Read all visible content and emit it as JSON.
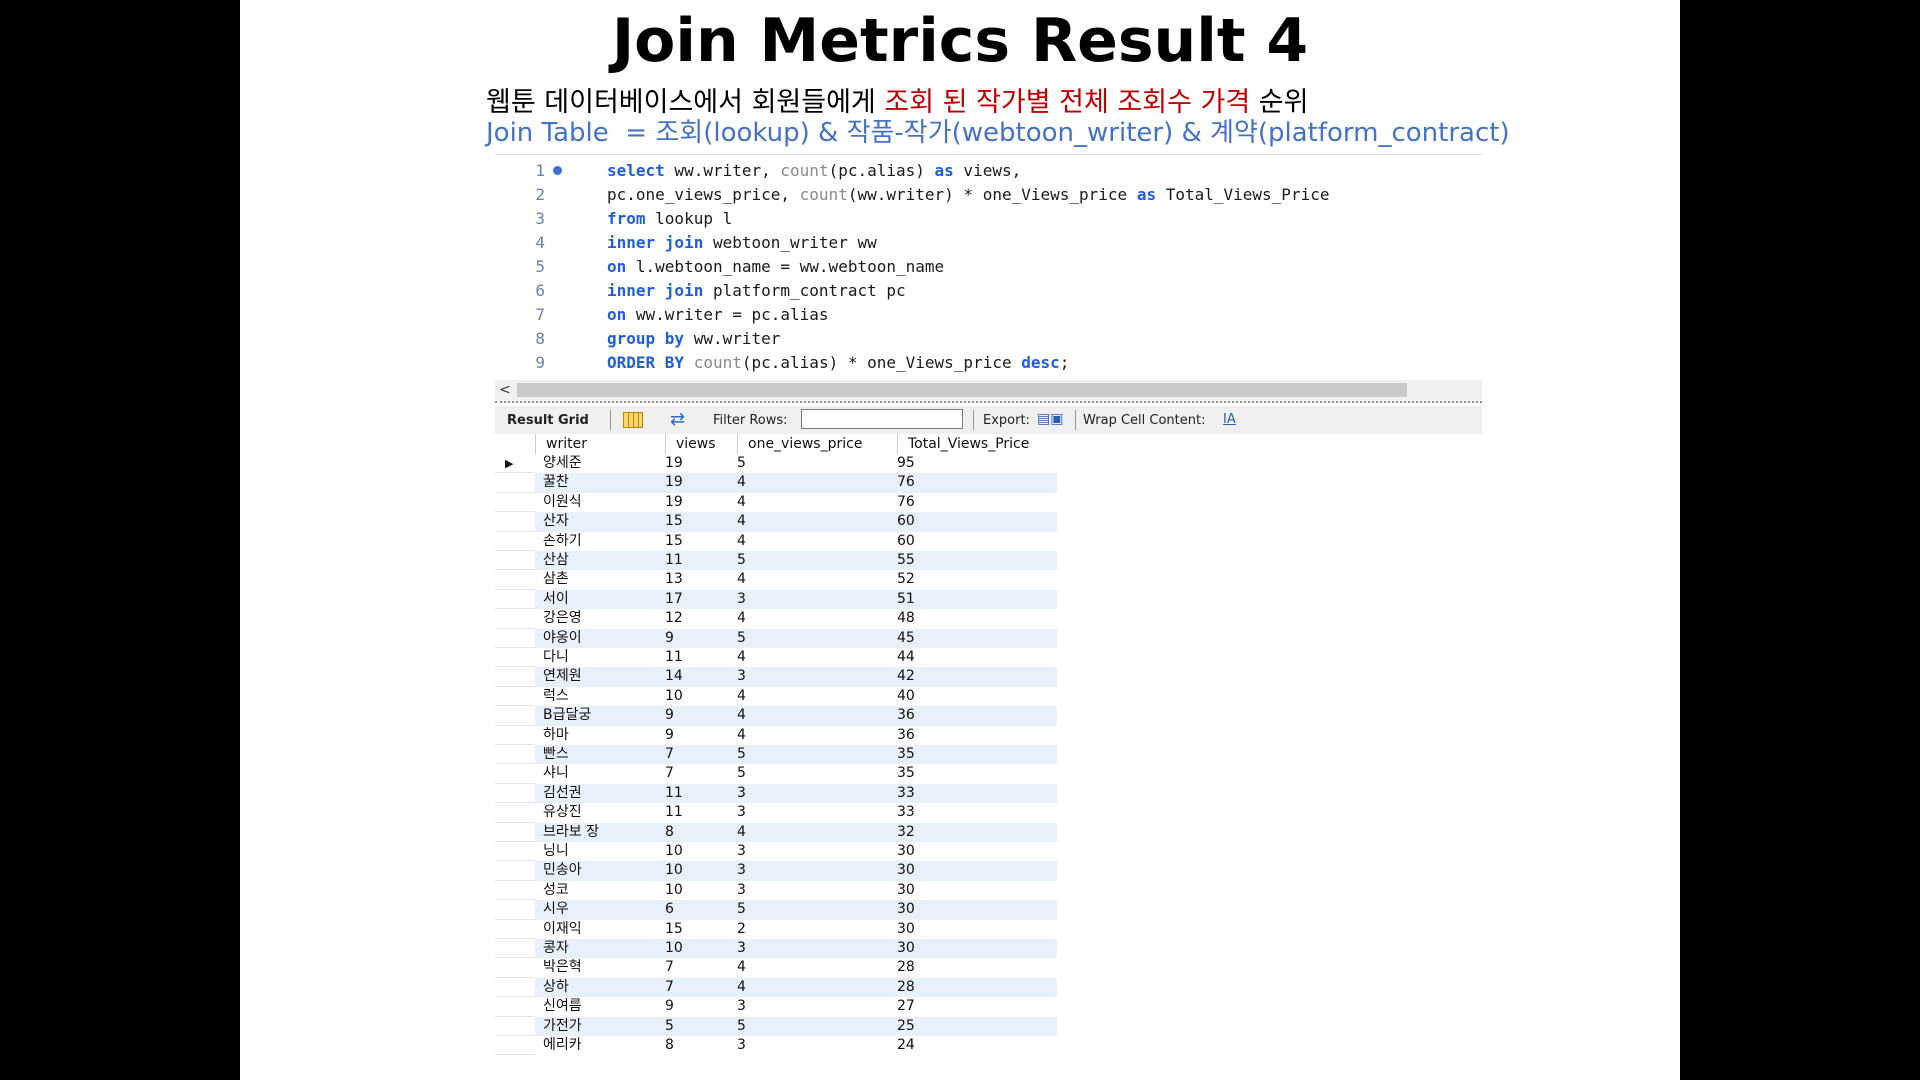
{
  "slide": {
    "title": "Join Metrics Result 4",
    "subtitle_prefix": "웹툰 데이터베이스에서 회원들에게 ",
    "subtitle_highlight": "조회 된 작가별 전체 조회수 가격",
    "subtitle_suffix": " 순위",
    "join_line": "Join Table  = 조회(lookup) & 작품-작가(webtoon_writer) & 계약(platform_contract)"
  },
  "editor": {
    "lines": [
      {
        "n": "1",
        "tokens": [
          [
            "kw",
            "select"
          ],
          [
            "t",
            " ww.writer, "
          ],
          [
            "fn",
            "count"
          ],
          [
            "t",
            "(pc.alias) "
          ],
          [
            "kw",
            "as"
          ],
          [
            "t",
            " views,"
          ]
        ]
      },
      {
        "n": "2",
        "tokens": [
          [
            "t",
            "pc.one_views_price, "
          ],
          [
            "fn",
            "count"
          ],
          [
            "t",
            "(ww.writer) * one_Views_price "
          ],
          [
            "kw",
            "as"
          ],
          [
            "t",
            " Total_Views_Price"
          ]
        ]
      },
      {
        "n": "3",
        "tokens": [
          [
            "kw",
            "from"
          ],
          [
            "t",
            " lookup l"
          ]
        ]
      },
      {
        "n": "4",
        "tokens": [
          [
            "kw",
            "inner join"
          ],
          [
            "t",
            " webtoon_writer ww"
          ]
        ]
      },
      {
        "n": "5",
        "tokens": [
          [
            "kw",
            "on"
          ],
          [
            "t",
            " l.webtoon_name = ww.webtoon_name"
          ]
        ]
      },
      {
        "n": "6",
        "tokens": [
          [
            "kw",
            "inner join"
          ],
          [
            "t",
            " platform_contract pc"
          ]
        ]
      },
      {
        "n": "7",
        "tokens": [
          [
            "kw",
            "on"
          ],
          [
            "t",
            " ww.writer = pc.alias"
          ]
        ]
      },
      {
        "n": "8",
        "tokens": [
          [
            "kw",
            "group by"
          ],
          [
            "t",
            " ww.writer"
          ]
        ]
      },
      {
        "n": "9",
        "tokens": [
          [
            "kw",
            "ORDER BY"
          ],
          [
            "t",
            " "
          ],
          [
            "fn",
            "count"
          ],
          [
            "t",
            "(pc.alias) * one_Views_price "
          ],
          [
            "kw",
            "desc"
          ],
          [
            "t",
            ";"
          ]
        ]
      }
    ]
  },
  "toolbar": {
    "result_grid": "Result Grid",
    "filter_rows": "Filter Rows:",
    "filter_value": "",
    "export": "Export:",
    "wrap": "Wrap Cell Content:",
    "wrap_icon": "IA"
  },
  "grid": {
    "columns": [
      "writer",
      "views",
      "one_views_price",
      "Total_Views_Price"
    ],
    "rows": [
      [
        "양세준",
        "19",
        "5",
        "95"
      ],
      [
        "꿀찬",
        "19",
        "4",
        "76"
      ],
      [
        "이원식",
        "19",
        "4",
        "76"
      ],
      [
        "산자",
        "15",
        "4",
        "60"
      ],
      [
        "손하기",
        "15",
        "4",
        "60"
      ],
      [
        "산삼",
        "11",
        "5",
        "55"
      ],
      [
        "삼촌",
        "13",
        "4",
        "52"
      ],
      [
        "서이",
        "17",
        "3",
        "51"
      ],
      [
        "강은영",
        "12",
        "4",
        "48"
      ],
      [
        "야옹이",
        "9",
        "5",
        "45"
      ],
      [
        "다니",
        "11",
        "4",
        "44"
      ],
      [
        "연제원",
        "14",
        "3",
        "42"
      ],
      [
        "럭스",
        "10",
        "4",
        "40"
      ],
      [
        "B급달궁",
        "9",
        "4",
        "36"
      ],
      [
        "하마",
        "9",
        "4",
        "36"
      ],
      [
        "빤스",
        "7",
        "5",
        "35"
      ],
      [
        "샤니",
        "7",
        "5",
        "35"
      ],
      [
        "김선권",
        "11",
        "3",
        "33"
      ],
      [
        "유상진",
        "11",
        "3",
        "33"
      ],
      [
        "브라보 장",
        "8",
        "4",
        "32"
      ],
      [
        "닝니",
        "10",
        "3",
        "30"
      ],
      [
        "민송아",
        "10",
        "3",
        "30"
      ],
      [
        "성코",
        "10",
        "3",
        "30"
      ],
      [
        "시우",
        "6",
        "5",
        "30"
      ],
      [
        "이재익",
        "15",
        "2",
        "30"
      ],
      [
        "콩자",
        "10",
        "3",
        "30"
      ],
      [
        "박은혁",
        "7",
        "4",
        "28"
      ],
      [
        "상하",
        "7",
        "4",
        "28"
      ],
      [
        "신여름",
        "9",
        "3",
        "27"
      ],
      [
        "가전가",
        "5",
        "5",
        "25"
      ],
      [
        "에리카",
        "8",
        "3",
        "24"
      ]
    ]
  }
}
